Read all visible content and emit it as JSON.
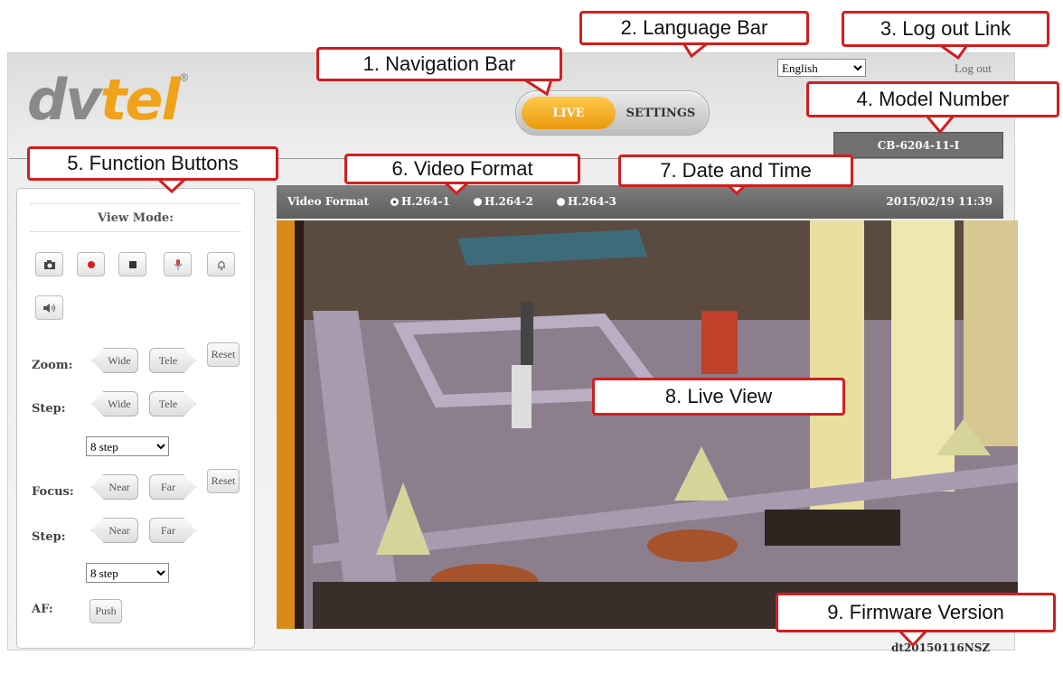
{
  "logo": {
    "part1": "dv",
    "part2": "tel",
    "mark": "®"
  },
  "nav": {
    "live": "LIVE",
    "settings": "SETTINGS"
  },
  "language": {
    "selected": "English"
  },
  "logout": "Log out",
  "model": "CB-6204-11-I",
  "panel": {
    "view_mode": "View Mode:",
    "icons": [
      "camera-icon",
      "record-icon",
      "stop-icon",
      "microphone-icon",
      "alarm-bell-icon",
      "speaker-icon"
    ],
    "zoom_label": "Zoom:",
    "zoom_step_label": "Step:",
    "focus_label": "Focus:",
    "focus_step_label": "Step:",
    "af_label": "AF:",
    "wide": "Wide",
    "tele": "Tele",
    "near": "Near",
    "far": "Far",
    "reset": "Reset",
    "push": "Push",
    "zoom_step_value": "8 step",
    "focus_step_value": "8 step"
  },
  "video": {
    "format_label": "Video Format",
    "formats": [
      "H.264-1",
      "H.264-2",
      "H.264-3"
    ],
    "selected_index": 0,
    "datetime": "2015/02/19 11:39"
  },
  "firmware": "dt20150116NSZ",
  "callouts": {
    "nav": "1. Navigation Bar",
    "lang": "2. Language Bar",
    "logout": "3. Log out Link",
    "model": "4. Model Number",
    "functions": "5. Function Buttons",
    "format": "6. Video Format",
    "datetime": "7. Date and Time",
    "live": "8. Live View",
    "firmware": "9. Firmware Version"
  },
  "colors": {
    "accent": "#f0a21a",
    "callout_border": "#d21e1e"
  }
}
